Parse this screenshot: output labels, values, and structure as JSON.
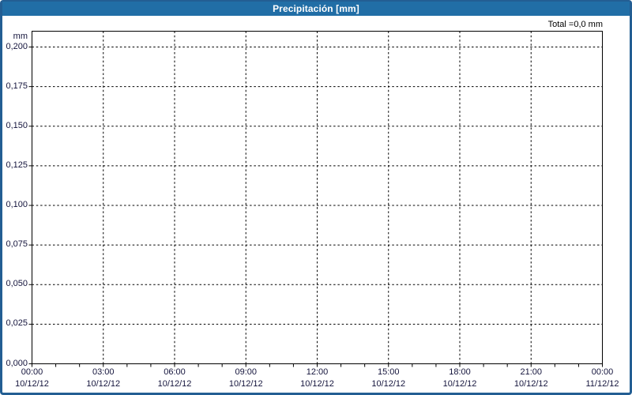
{
  "title_bar": {
    "title": "Precipitación [mm]"
  },
  "summary": {
    "total_text": "Total =0,0 mm"
  },
  "colors": {
    "header_bg": "#216ea6",
    "frame_border": "#235e93",
    "axis_text": "#14143c",
    "title_text": "#ffffff",
    "grid": "#000000",
    "plot_bg": "#ffffff"
  },
  "chart_data": {
    "type": "line",
    "title": "Precipitación [mm]",
    "xlabel": "",
    "ylabel": "mm",
    "unit": "mm",
    "total_text": "Total =0,0 mm",
    "grid": "dashed",
    "legend": "none",
    "ylim": [
      0,
      0.21
    ],
    "xlim_hours": [
      0,
      24
    ],
    "y_ticks": [
      "0,200",
      "0,175",
      "0,150",
      "0,125",
      "0,100",
      "0,075",
      "0,050",
      "0,025",
      "0,000"
    ],
    "y_tick_values": [
      0.2,
      0.175,
      0.15,
      0.125,
      0.1,
      0.075,
      0.05,
      0.025,
      0.0
    ],
    "x_major_ticks": [
      {
        "time": "00:00",
        "date": "10/12/12"
      },
      {
        "time": "03:00",
        "date": "10/12/12"
      },
      {
        "time": "06:00",
        "date": "10/12/12"
      },
      {
        "time": "09:00",
        "date": "10/12/12"
      },
      {
        "time": "12:00",
        "date": "10/12/12"
      },
      {
        "time": "15:00",
        "date": "10/12/12"
      },
      {
        "time": "18:00",
        "date": "10/12/12"
      },
      {
        "time": "21:00",
        "date": "10/12/12"
      },
      {
        "time": "00:00",
        "date": "11/12/12"
      }
    ],
    "x_minor_hours_per_major": 3,
    "series": []
  }
}
